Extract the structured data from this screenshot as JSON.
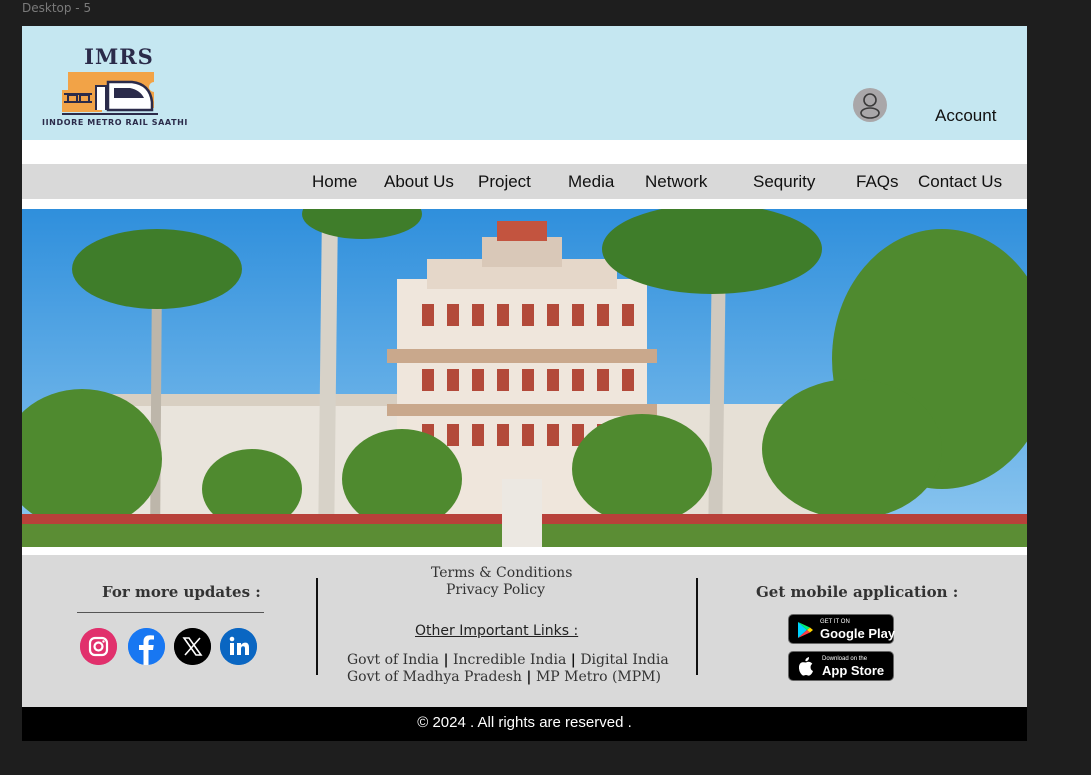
{
  "frame_label": "Desktop - 5",
  "header": {
    "logo_title": "IMRS",
    "logo_subtitle": "IINDORE METRO RAIL SAATHI",
    "account_label": "Account"
  },
  "nav": {
    "items": [
      "Home",
      "About Us",
      "Project",
      "Media",
      "Network",
      "Sequrity",
      "FAQs",
      "Contact Us"
    ]
  },
  "hero": {
    "image": "Indore palace with palm trees"
  },
  "footer": {
    "updates_heading": "For more updates :",
    "social": [
      "instagram-icon",
      "facebook-icon",
      "x-icon",
      "linkedin-icon"
    ],
    "terms": "Terms & Conditions",
    "privacy": "Privacy Policy",
    "other_links_heading": "Other Important Links :",
    "links_row1": [
      "Govt of India",
      "Incredible India",
      "Digital India"
    ],
    "links_row2": [
      "Govt of Madhya Pradesh",
      "MP Metro (MPM)"
    ],
    "app_heading": "Get mobile application :",
    "google_play": {
      "small": "GET IT ON",
      "big": "Google Play"
    },
    "app_store": {
      "small": "Download on the",
      "big": "App Store"
    },
    "copyright": "© 2024 . All rights are reserved ."
  },
  "colors": {
    "header_bg": "#c5e7f1",
    "nav_bg": "#d9d9d9",
    "footer_bg": "#d9d9d9",
    "logo_orange": "#f2a347"
  }
}
